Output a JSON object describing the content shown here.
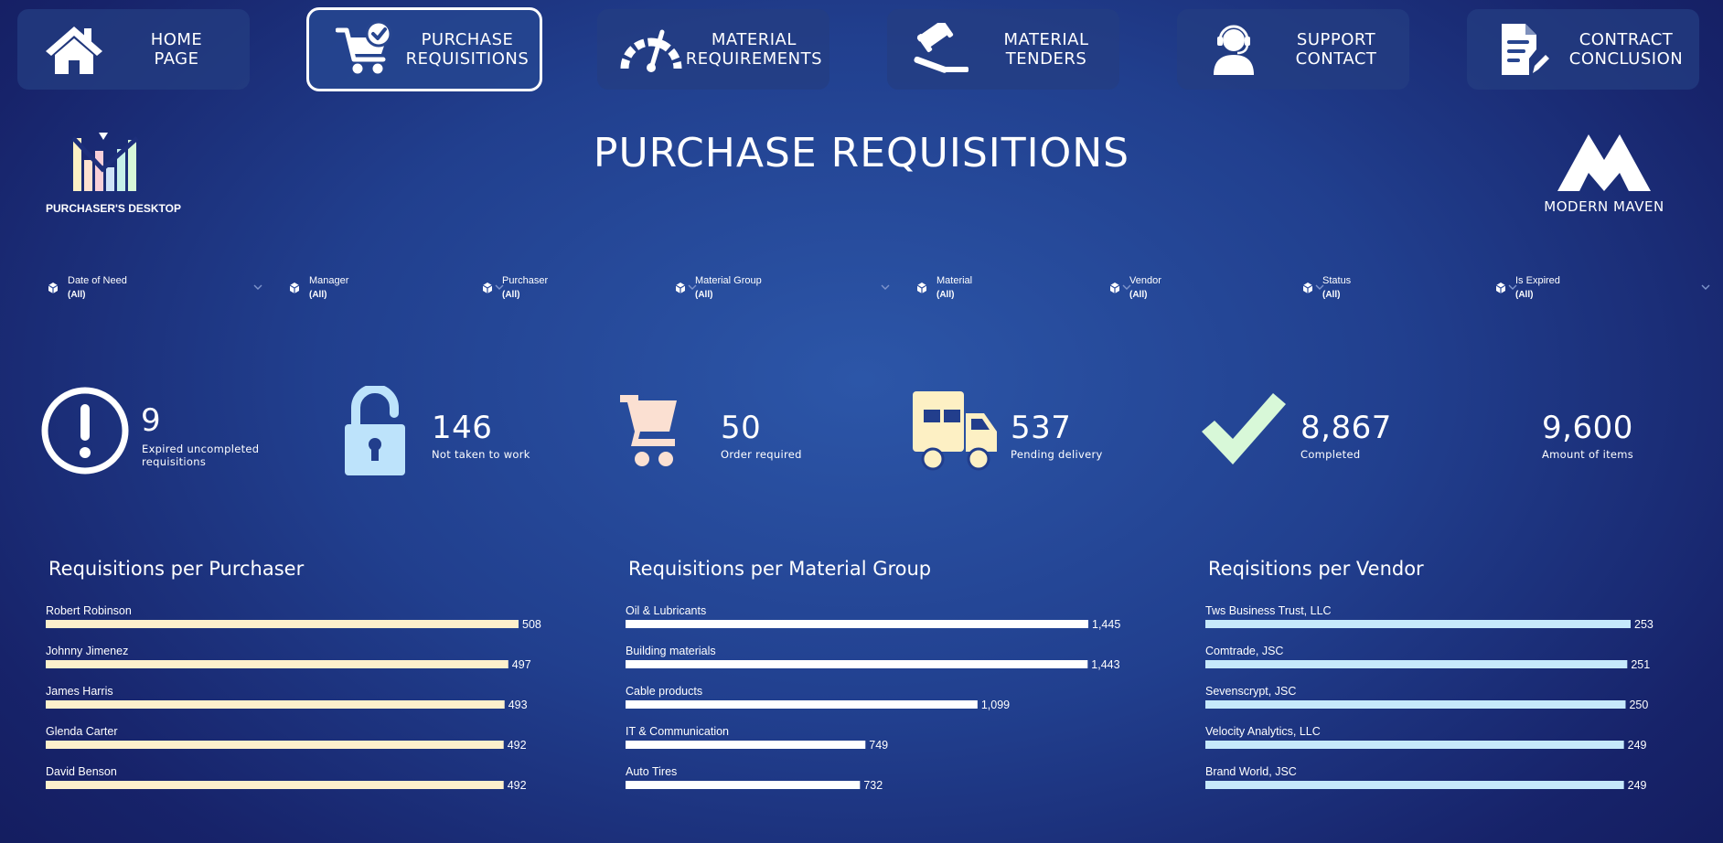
{
  "nav": [
    {
      "id": "home",
      "line1": "HOME",
      "line2": "PAGE",
      "icon": "home-icon"
    },
    {
      "id": "purchase",
      "line1": "PURCHASE",
      "line2": "REQUISITIONS",
      "icon": "cart-check-icon",
      "active": true
    },
    {
      "id": "material-req",
      "line1": "MATERIAL",
      "line2": "REQUIREMENTS",
      "icon": "gauge-icon"
    },
    {
      "id": "tenders",
      "line1": "MATERIAL",
      "line2": "TENDERS",
      "icon": "gavel-icon"
    },
    {
      "id": "support",
      "line1": "SUPPORT",
      "line2": "CONTACT",
      "icon": "headset-icon"
    },
    {
      "id": "contract",
      "line1": "CONTRACT",
      "line2": "CONCLUSION",
      "icon": "document-pen-icon"
    }
  ],
  "header": {
    "title": "PURCHASE REQUISITIONS",
    "brand_left": "PURCHASER'S DESKTOP",
    "brand_right": "MODERN MAVEN"
  },
  "filters": [
    {
      "label": "Date of Need",
      "value": "(All)"
    },
    {
      "label": "Manager",
      "value": "(All)"
    },
    {
      "label": "Purchaser",
      "value": "(All)"
    },
    {
      "label": "Material Group",
      "value": "(All)"
    },
    {
      "label": "Material",
      "value": "(All)"
    },
    {
      "label": "Vendor",
      "value": "(All)"
    },
    {
      "label": "Status",
      "value": "(All)"
    },
    {
      "label": "Is Expired",
      "value": "(All)"
    }
  ],
  "kpis": {
    "expired": {
      "value": "9",
      "label_line1": "Expired uncompleted",
      "label_line2": "requisitions",
      "icon": "exclamation-circle-icon"
    },
    "not_taken": {
      "value": "146",
      "label": "Not taken to work",
      "icon": "unlock-icon"
    },
    "order_required": {
      "value": "50",
      "label": "Order required",
      "icon": "cart-icon"
    },
    "pending": {
      "value": "537",
      "label": "Pending delivery",
      "icon": "truck-icon"
    },
    "completed": {
      "value": "8,867",
      "label": "Completed",
      "icon": "checkmark-icon"
    },
    "amount": {
      "value": "9,600",
      "label": "Amount of items"
    }
  },
  "colors": {
    "purchaser_bar": "#fdf0cc",
    "material_bar": "#ffffff",
    "vendor_bar": "#c6e9fb",
    "unlock_icon": "#bde3fb",
    "cart_icon": "#fbe0d2",
    "truck_icon": "#fdf0c4",
    "check_icon": "#d8f8d8"
  },
  "chart_data": [
    {
      "type": "bar",
      "orientation": "horizontal",
      "title": "Requisitions per Purchaser",
      "categories": [
        "Robert Robinson",
        "Johnny Jimenez",
        "James Harris",
        "Glenda Carter",
        "David Benson"
      ],
      "values": [
        508,
        497,
        493,
        492,
        492
      ],
      "value_labels": [
        "508",
        "497",
        "493",
        "492",
        "492"
      ]
    },
    {
      "type": "bar",
      "orientation": "horizontal",
      "title": "Requisitions per Material Group",
      "categories": [
        "Oil & Lubricants",
        "Building materials",
        "Cable products",
        "IT & Communication",
        "Auto Tires"
      ],
      "values": [
        1445,
        1443,
        1099,
        749,
        732
      ],
      "value_labels": [
        "1,445",
        "1,443",
        "1,099",
        "749",
        "732"
      ]
    },
    {
      "type": "bar",
      "orientation": "horizontal",
      "title": "Reqisitions per Vendor",
      "categories": [
        "Tws Business Trust, LLC",
        "Comtrade, JSC",
        "Sevenscrypt, JSC",
        "Velocity Analytics, LLC",
        "Brand World, JSC"
      ],
      "values": [
        253,
        251,
        250,
        249,
        249
      ],
      "value_labels": [
        "253",
        "251",
        "250",
        "249",
        "249"
      ]
    }
  ]
}
